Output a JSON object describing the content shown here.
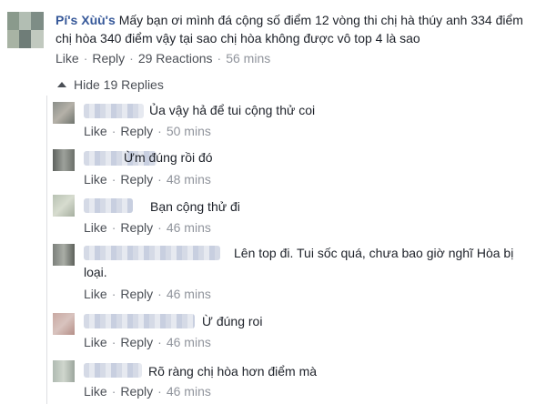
{
  "main_comment": {
    "author": "Pí's Xùù's",
    "text": "Mấy bạn ơi mình đá cộng số điểm 12 vòng thi chị hà thúy anh 334 điểm chị hòa 340 điểm vậy tại sao chị hòa không được vô top 4 là sao",
    "like": "Like",
    "reply": "Reply",
    "reactions": "29 Reactions",
    "time": "56 mins"
  },
  "hide_replies": "Hide 19 Replies",
  "replies": [
    {
      "text": "Ủa vậy hả để tui cộng thử coi",
      "like": "Like",
      "reply": "Reply",
      "time": "50 mins"
    },
    {
      "text": "Ừm đúng rồi đó",
      "like": "Like",
      "reply": "Reply",
      "time": "48 mins"
    },
    {
      "text": "Bạn cộng thử đi",
      "like": "Like",
      "reply": "Reply",
      "time": "46 mins"
    },
    {
      "text": "Lên top đi. Tui sốc quá, chưa bao giờ nghĩ Hòa bị loại.",
      "like": "Like",
      "reply": "Reply",
      "time": "46 mins"
    },
    {
      "text": "Ừ đúng roi",
      "like": "Like",
      "reply": "Reply",
      "time": "46 mins"
    },
    {
      "text": "Rõ ràng chị hòa hơn điểm mà",
      "like": "Like",
      "reply": "Reply",
      "time": "46 mins"
    }
  ],
  "colors": {
    "author_link": "#365899",
    "meta_gray": "#90949c",
    "thread_line": "#dddfe2"
  }
}
